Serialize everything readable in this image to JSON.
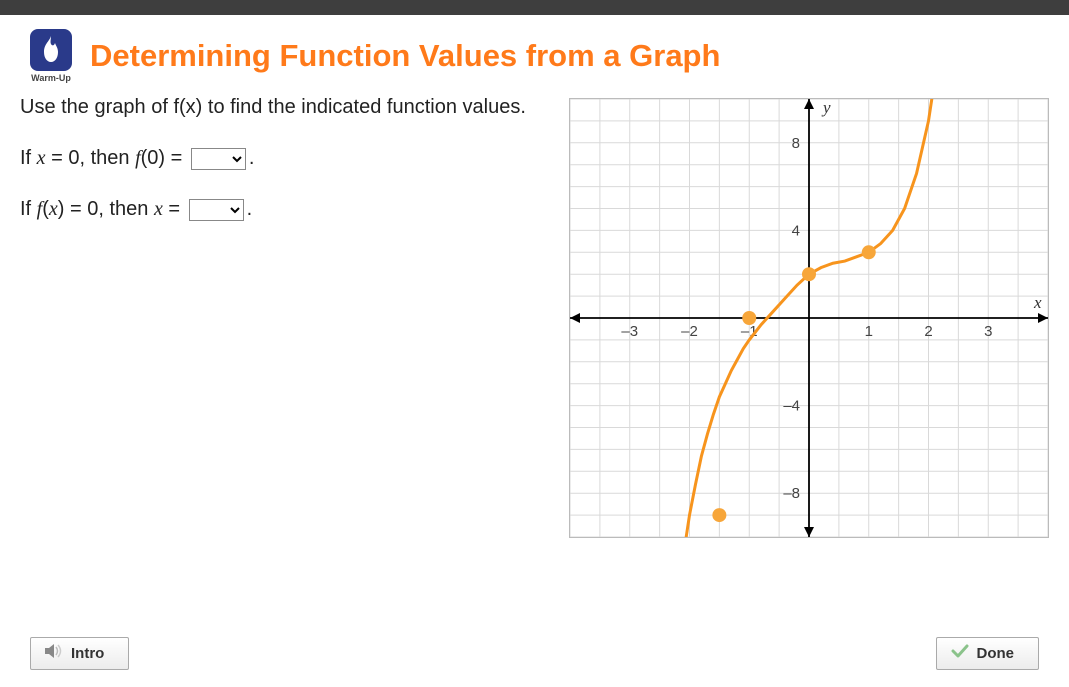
{
  "header": {
    "badge_label": "Warm-Up",
    "title": "Determining Function Values from a Graph"
  },
  "instruction": "Use the graph of f(x) to find the indicated function values.",
  "questions": {
    "q1_prefix": "If ",
    "q1_var": "x",
    "q1_mid": " = 0, then ",
    "q1_func": "f",
    "q1_arg": "(0) = ",
    "q1_suffix": ".",
    "q2_prefix": "If ",
    "q2_func": "f",
    "q2_arg_open": "(",
    "q2_arg_var": "x",
    "q2_arg_close": ") = 0, then ",
    "q2_var2": "x",
    "q2_eq": " = ",
    "q2_suffix": "."
  },
  "footer": {
    "intro_label": "Intro",
    "done_label": "Done"
  },
  "chart_data": {
    "type": "line",
    "title": "",
    "xlabel": "x",
    "ylabel": "y",
    "xlim": [
      -4,
      4
    ],
    "ylim": [
      -10,
      10
    ],
    "x_ticks": [
      -3,
      -2,
      -1,
      0,
      1,
      2,
      3
    ],
    "y_ticks": [
      -8,
      -4,
      0,
      4,
      8
    ],
    "series": [
      {
        "name": "f(x)",
        "x": [
          -2.2,
          -2.0,
          -1.9,
          -1.8,
          -1.7,
          -1.6,
          -1.5,
          -1.4,
          -1.3,
          -1.2,
          -1.1,
          -1.0,
          -0.8,
          -0.6,
          -0.4,
          -0.2,
          0.0,
          0.2,
          0.4,
          0.6,
          0.8,
          1.0,
          1.2,
          1.4,
          1.6,
          1.8,
          2.0,
          2.2
        ],
        "y": [
          -12.6,
          -9.0,
          -7.6,
          -6.3,
          -5.3,
          -4.4,
          -3.6,
          -3.0,
          -2.4,
          -1.9,
          -1.4,
          -1.0,
          -0.3,
          0.3,
          0.9,
          1.5,
          2.0,
          2.3,
          2.5,
          2.6,
          2.8,
          3.0,
          3.4,
          4.0,
          5.0,
          6.6,
          9.0,
          12.6
        ],
        "color": "#f7941d"
      }
    ],
    "marked_points": [
      {
        "x": -1.5,
        "y": -9.0
      },
      {
        "x": -1.0,
        "y": 0.0
      },
      {
        "x": 0.0,
        "y": 2.0
      },
      {
        "x": 1.0,
        "y": 3.0
      }
    ]
  }
}
